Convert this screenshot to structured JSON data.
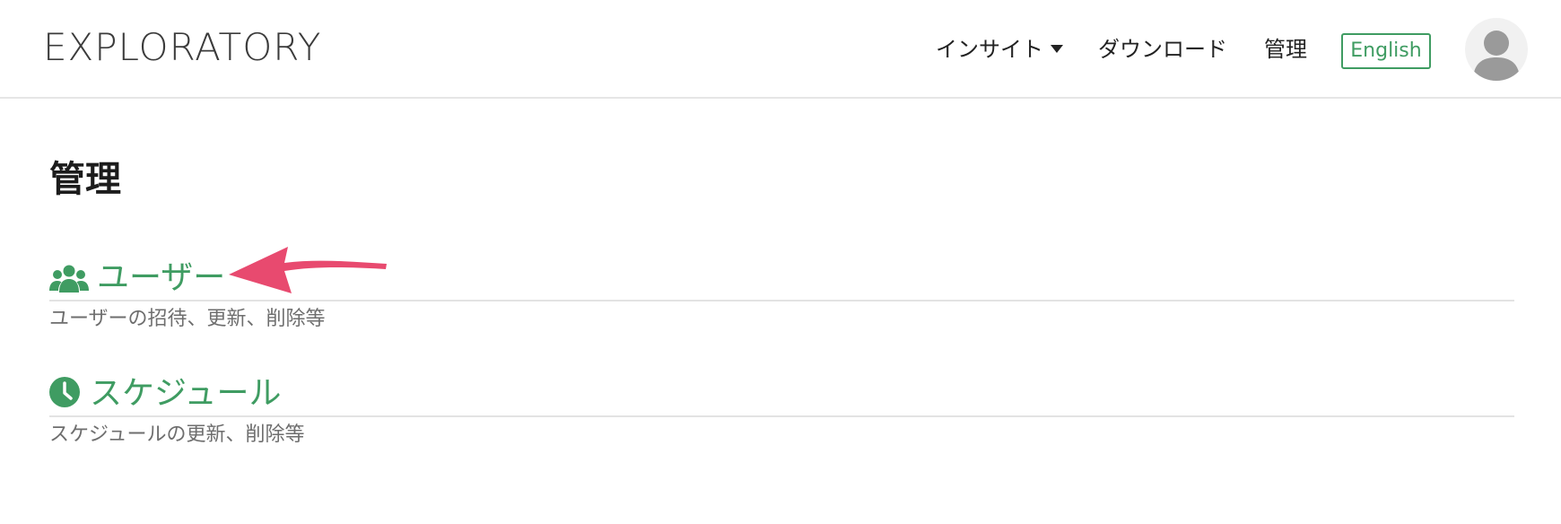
{
  "header": {
    "logo": "EXPLORATORY",
    "nav": {
      "insight": "インサイト",
      "download": "ダウンロード",
      "admin": "管理"
    },
    "language_button": "English"
  },
  "main": {
    "title": "管理",
    "sections": [
      {
        "label": "ユーザー",
        "description": "ユーザーの招待、更新、削除等",
        "icon": "users-icon"
      },
      {
        "label": "スケジュール",
        "description": "スケジュールの更新、削除等",
        "icon": "clock-icon"
      }
    ]
  },
  "colors": {
    "accent": "#3f9c62",
    "annotation_arrow": "#e84a6f",
    "text": "#222222",
    "muted": "#6e6e6e"
  }
}
